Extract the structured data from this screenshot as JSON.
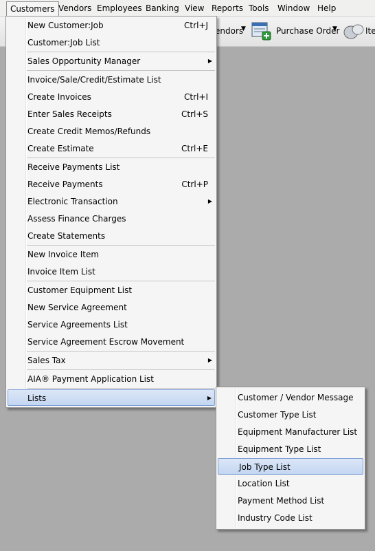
{
  "menubar": [
    {
      "label": "Customers",
      "active": true
    },
    {
      "label": "Vendors"
    },
    {
      "label": "Employees"
    },
    {
      "label": "Banking"
    },
    {
      "label": "View"
    },
    {
      "label": "Reports"
    },
    {
      "label": "Tools"
    },
    {
      "label": "Window"
    },
    {
      "label": "Help"
    }
  ],
  "toolbar": {
    "vendors_label": "endors",
    "purchase_order_label": "Purchase Order",
    "items_label": "Ite"
  },
  "customers_menu": [
    {
      "label": "New Customer:Job",
      "shortcut": "Ctrl+J"
    },
    {
      "label": "Customer:Job List"
    },
    {
      "label": "Sales Opportunity Manager",
      "submenu": true
    },
    {
      "label": "Invoice/Sale/Credit/Estimate List"
    },
    {
      "label": "Create Invoices",
      "shortcut": "Ctrl+I"
    },
    {
      "label": "Enter Sales Receipts",
      "shortcut": "Ctrl+S"
    },
    {
      "label": "Create Credit Memos/Refunds"
    },
    {
      "label": "Create Estimate",
      "shortcut": "Ctrl+E"
    },
    {
      "label": "Receive Payments List"
    },
    {
      "label": "Receive Payments",
      "shortcut": "Ctrl+P"
    },
    {
      "label": "Electronic Transaction",
      "submenu": true
    },
    {
      "label": "Assess Finance Charges"
    },
    {
      "label": "Create Statements"
    },
    {
      "label": "New Invoice Item"
    },
    {
      "label": "Invoice Item List"
    },
    {
      "label": "Customer Equipment List"
    },
    {
      "label": "New Service Agreement"
    },
    {
      "label": "Service Agreements List"
    },
    {
      "label": "Service Agreement Escrow Movement"
    },
    {
      "label": "Sales Tax",
      "submenu": true
    },
    {
      "label": "AIA® Payment Application List"
    },
    {
      "label": "Lists",
      "submenu": true,
      "highlighted": true
    }
  ],
  "lists_submenu": [
    {
      "label": "Customer / Vendor Message"
    },
    {
      "label": "Customer Type List"
    },
    {
      "label": "Equipment Manufacturer List"
    },
    {
      "label": "Equipment Type List"
    },
    {
      "label": "Job Type List",
      "highlighted": true
    },
    {
      "label": "Location List"
    },
    {
      "label": "Payment Method List"
    },
    {
      "label": "Industry Code List"
    }
  ]
}
